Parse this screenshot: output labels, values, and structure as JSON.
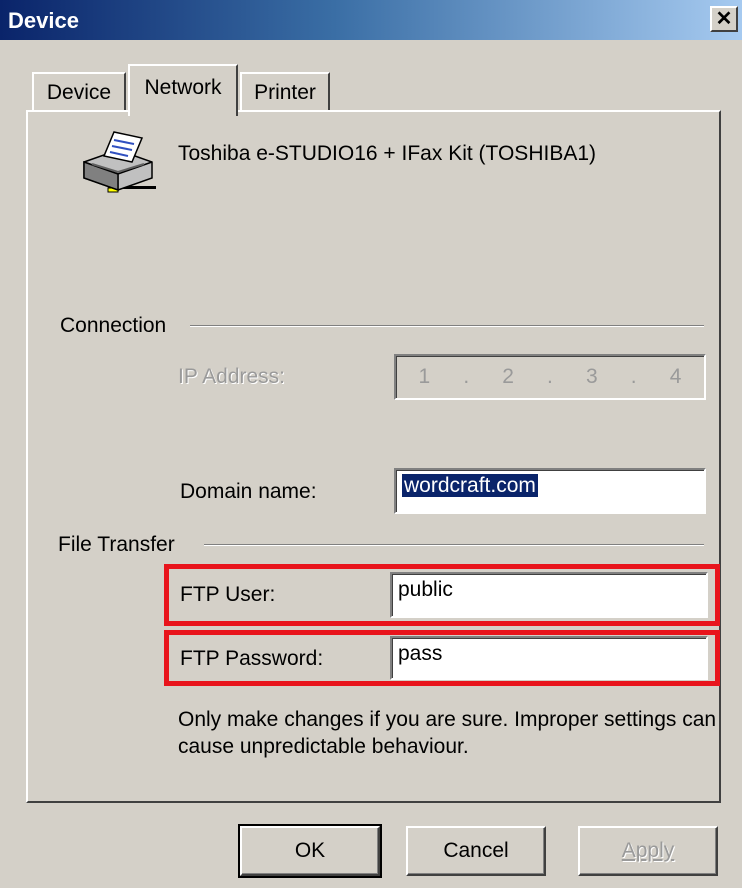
{
  "window": {
    "title": "Device",
    "close_symbol": "✕"
  },
  "tabs": [
    {
      "label": "Device",
      "active": false
    },
    {
      "label": "Network",
      "active": true
    },
    {
      "label": "Printer",
      "active": false
    }
  ],
  "device": {
    "name": "Toshiba e-STUDIO16 + IFax Kit (TOSHIBA1)",
    "icon": "printer-icon"
  },
  "connection": {
    "group_label": "Connection",
    "ip_label": "IP Address:",
    "ip_octets": [
      "1",
      "2",
      "3",
      "4"
    ],
    "ip_separator": ".",
    "domain_label": "Domain name:",
    "domain_value": "wordcraft.com"
  },
  "file_transfer": {
    "group_label": "File Transfer",
    "ftp_user_label": "FTP User:",
    "ftp_user_value": "public",
    "ftp_password_label": "FTP Password:",
    "ftp_password_value": "pass"
  },
  "warning": "Only make changes if you are sure. Improper settings can cause unpredictable behaviour.",
  "buttons": {
    "ok": "OK",
    "cancel": "Cancel",
    "apply": "Apply"
  },
  "colors": {
    "highlight": "#e8141c",
    "title_bar": "#0a246a",
    "selection": "#0a246a"
  }
}
